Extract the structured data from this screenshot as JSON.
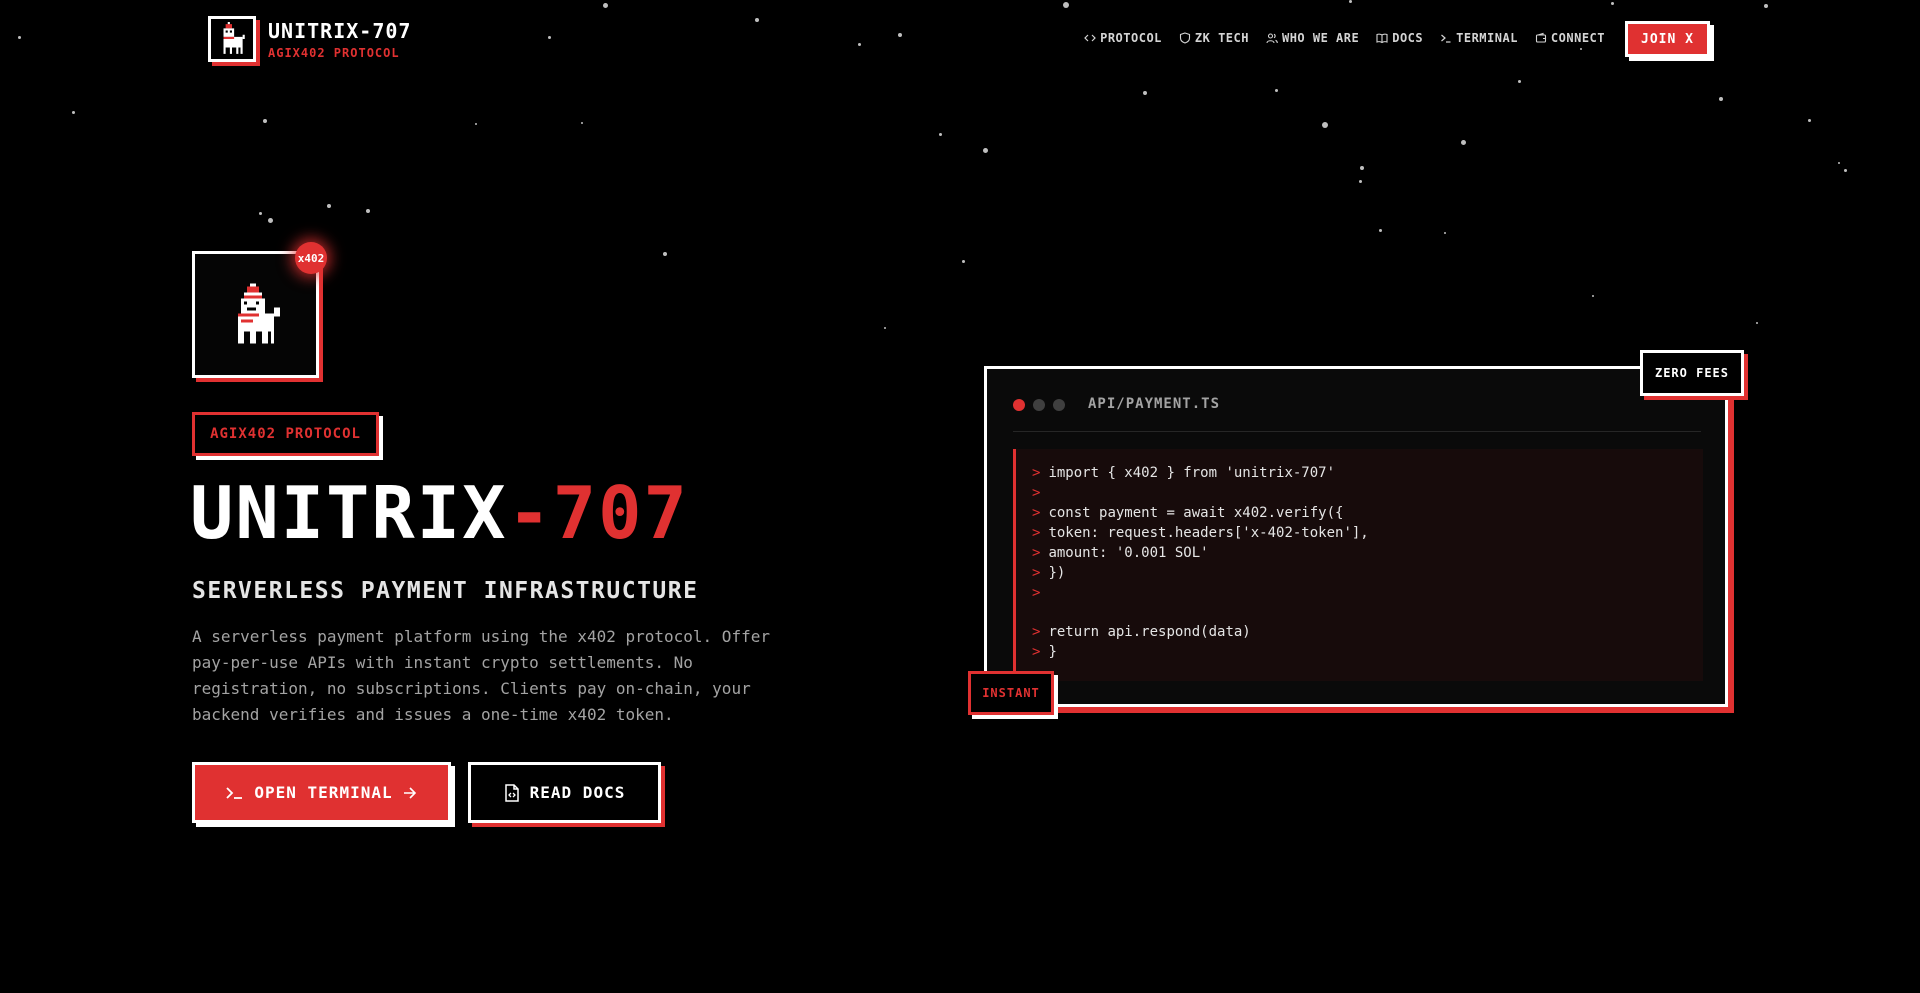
{
  "brand": {
    "name": "UNITRIX-707",
    "subtitle": "AGIX402 PROTOCOL"
  },
  "nav": {
    "items": [
      {
        "label": "PROTOCOL",
        "icon": "code-icon"
      },
      {
        "label": "ZK TECH",
        "icon": "shield-icon"
      },
      {
        "label": "WHO WE ARE",
        "icon": "users-icon"
      },
      {
        "label": "DOCS",
        "icon": "book-icon"
      },
      {
        "label": "TERMINAL",
        "icon": "terminal-icon"
      },
      {
        "label": "CONNECT",
        "icon": "wallet-icon"
      }
    ],
    "join_label": "JOIN X"
  },
  "hero": {
    "badge": "x402",
    "tag": "AGIX402 PROTOCOL",
    "title_main": "UNITRIX",
    "title_accent": "-707",
    "subtitle": "SERVERLESS PAYMENT INFRASTRUCTURE",
    "description": "A serverless payment platform using the x402 protocol. Offer pay-per-use APIs with instant crypto settlements. No registration, no subscriptions. Clients pay on-chain, your backend verifies and issues a one-time x402 token.",
    "primary_button": "OPEN TERMINAL",
    "secondary_button": "READ DOCS"
  },
  "terminal": {
    "filename": "API/PAYMENT.TS",
    "prompt": ">",
    "lines_top": [
      "import { x402 } from 'unitrix-707'",
      "",
      "const payment = await x402.verify({",
      "token: request.headers['x-402-token'],",
      "amount: '0.001 SOL'",
      "})",
      ""
    ],
    "lines_bottom": [
      "return api.respond(data)",
      "}"
    ],
    "badge_top": "ZERO FEES",
    "badge_bottom": "INSTANT"
  },
  "colors": {
    "accent": "#e03131",
    "background": "#000000",
    "text": "#ffffff"
  }
}
